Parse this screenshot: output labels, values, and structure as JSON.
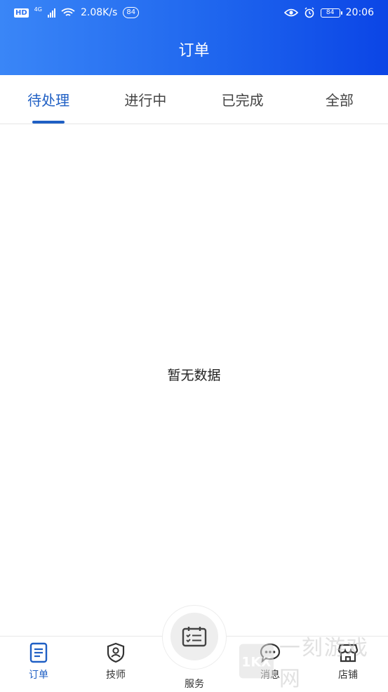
{
  "status_bar": {
    "hd": "HD",
    "network": "4G",
    "speed": "2.08K/s",
    "notification_count": "84",
    "battery": "84",
    "time": "20:06"
  },
  "header": {
    "title": "订单"
  },
  "tabs": [
    {
      "label": "待处理",
      "active": true
    },
    {
      "label": "进行中",
      "active": false
    },
    {
      "label": "已完成",
      "active": false
    },
    {
      "label": "全部",
      "active": false
    }
  ],
  "empty_state": {
    "text": "暂无数据"
  },
  "bottom_nav": {
    "items": [
      {
        "label": "订单",
        "icon": "order-list-icon",
        "active": true
      },
      {
        "label": "技师",
        "icon": "technician-shield-icon",
        "active": false
      },
      {
        "label": "服务",
        "icon": "service-calendar-icon",
        "active": false
      },
      {
        "label": "消息",
        "icon": "message-bubble-icon",
        "active": false
      },
      {
        "label": "店铺",
        "icon": "shop-store-icon",
        "active": false
      }
    ]
  },
  "watermark": {
    "text": "一刻游戏网",
    "logo_text": "1KX"
  },
  "colors": {
    "primary": "#1f5fc4",
    "header_start": "#3a86f7",
    "header_end": "#0b45e6"
  }
}
